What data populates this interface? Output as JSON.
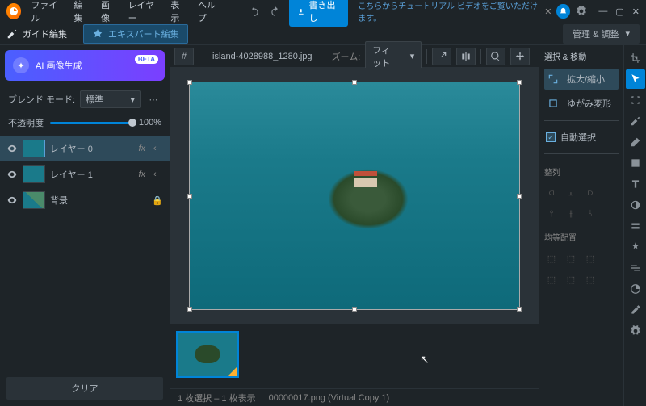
{
  "menu": {
    "file": "ファイル",
    "edit": "編集",
    "image": "画像",
    "layer": "レイヤー",
    "view": "表示",
    "help": "ヘルプ"
  },
  "titlebar": {
    "export": "書き出し",
    "tutorial": "こちらからチュートリアル ビデオをご覧いただけます。"
  },
  "toolbar": {
    "guide": "ガイド編集",
    "expert": "エキスパート編集",
    "manage": "管理 & 調整"
  },
  "ai": {
    "label": "AI 画像生成",
    "badge": "BETA"
  },
  "blend": {
    "label": "ブレンド モード:",
    "value": "標準"
  },
  "opacity": {
    "label": "不透明度",
    "value": "100%",
    "pct": 100
  },
  "layers": [
    {
      "name": "レイヤー 0",
      "fx": true,
      "sel": true,
      "bg": false,
      "lock": false
    },
    {
      "name": "レイヤー 1",
      "fx": true,
      "sel": false,
      "bg": false,
      "lock": false
    },
    {
      "name": "背景",
      "fx": false,
      "sel": false,
      "bg": true,
      "lock": true
    }
  ],
  "clear": "クリア",
  "canvas": {
    "file": "island-4028988_1280.jpg",
    "zoom_label": "ズーム:",
    "zoom_value": "フィット"
  },
  "status": {
    "sel": "1 枚選択 – 1 枚表示",
    "file": "00000017.png (Virtual Copy 1)"
  },
  "right": {
    "title": "選択 & 移動",
    "zoom": "拡大/縮小",
    "warp": "ゆがみ変形",
    "autosel": "自動選択",
    "align": "整列",
    "dist": "均等配置"
  }
}
